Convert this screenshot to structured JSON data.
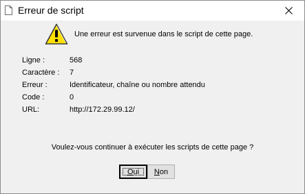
{
  "window": {
    "title": "Erreur de script"
  },
  "message": {
    "headline": "Une erreur est survenue dans le script de cette page.",
    "icon": "warning-icon"
  },
  "details": [
    {
      "label": "Ligne :",
      "value": "568"
    },
    {
      "label": "Caractère :",
      "value": "7"
    },
    {
      "label": "Erreur :",
      "value": "Identificateur, chaîne ou nombre attendu"
    },
    {
      "label": "Code :",
      "value": "0"
    },
    {
      "label": "URL:",
      "value": "http://172.29.99.12/"
    }
  ],
  "question": "Voulez-vous continuer à exécuter les scripts de cette page ?",
  "buttons": {
    "yes": {
      "label_first": "O",
      "label_rest": "ui"
    },
    "no": {
      "label_first": "N",
      "label_rest": "on"
    }
  }
}
